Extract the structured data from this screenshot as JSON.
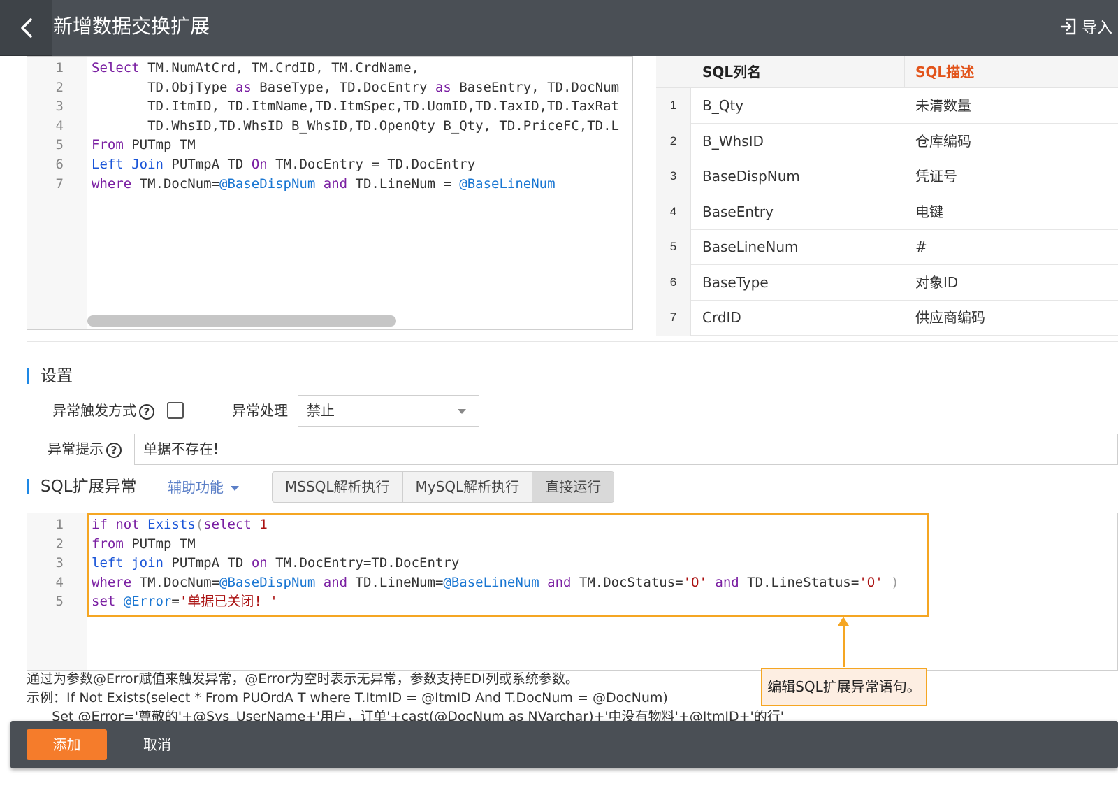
{
  "header": {
    "title": "新增数据交换扩展",
    "import_label": "导入"
  },
  "sql_editor": {
    "lines": [
      {
        "n": "1",
        "parts": [
          [
            "kw",
            "Select"
          ],
          [
            "t",
            " TM.NumAtCrd, TM.CrdID, TM.CrdName,"
          ]
        ]
      },
      {
        "n": "2",
        "parts": [
          [
            "t",
            "       TD.ObjType "
          ],
          [
            "kw",
            "as"
          ],
          [
            "t",
            " BaseType, TD.DocEntry "
          ],
          [
            "kw",
            "as"
          ],
          [
            "t",
            " BaseEntry, TD.DocNum"
          ]
        ]
      },
      {
        "n": "3",
        "parts": [
          [
            "t",
            "       TD.ItmID, TD.ItmName,TD.ItmSpec,TD.UomID,TD.TaxID,TD.TaxRat"
          ]
        ]
      },
      {
        "n": "4",
        "parts": [
          [
            "t",
            "       TD.WhsID,TD.WhsID B_WhsID,TD.OpenQty B_Qty, TD.PriceFC,TD.L"
          ]
        ]
      },
      {
        "n": "5",
        "parts": [
          [
            "kw",
            "From"
          ],
          [
            "t",
            " PUTmp TM"
          ]
        ]
      },
      {
        "n": "6",
        "parts": [
          [
            "kw2",
            "Left"
          ],
          [
            "t",
            " "
          ],
          [
            "kw2",
            "Join"
          ],
          [
            "t",
            " PUTmpA TD "
          ],
          [
            "kw",
            "On"
          ],
          [
            "t",
            " TM.DocEntry = TD.DocEntry"
          ]
        ]
      },
      {
        "n": "7",
        "parts": [
          [
            "kw",
            "where"
          ],
          [
            "t",
            " TM.DocNum="
          ],
          [
            "var",
            "@BaseDispNum"
          ],
          [
            "t",
            " "
          ],
          [
            "kw",
            "and"
          ],
          [
            "t",
            " TD.LineNum = "
          ],
          [
            "var",
            "@BaseLineNum"
          ]
        ]
      }
    ]
  },
  "sql_table": {
    "headers": [
      "SQL列名",
      "SQL描述"
    ],
    "rows": [
      {
        "idx": "1",
        "name": "B_Qty",
        "desc": "未清数量"
      },
      {
        "idx": "2",
        "name": "B_WhsID",
        "desc": "仓库编码"
      },
      {
        "idx": "3",
        "name": "BaseDispNum",
        "desc": "凭证号"
      },
      {
        "idx": "4",
        "name": "BaseEntry",
        "desc": "电键"
      },
      {
        "idx": "5",
        "name": "BaseLineNum",
        "desc": "#"
      },
      {
        "idx": "6",
        "name": "BaseType",
        "desc": "对象ID"
      },
      {
        "idx": "7",
        "name": "CrdID",
        "desc": "供应商编码"
      }
    ]
  },
  "settings": {
    "title": "设置",
    "trigger_label": "异常触发方式",
    "handling_label": "异常处理",
    "handling_value": "禁止",
    "prompt_label": "异常提示",
    "prompt_value": "单据不存在!"
  },
  "sql_exception": {
    "title": "SQL扩展异常",
    "aux_label": "辅助功能",
    "buttons": [
      "MSSQL解析执行",
      "MySQL解析执行",
      "直接运行"
    ],
    "lines": [
      {
        "n": "1",
        "parts": [
          [
            "kw",
            "if"
          ],
          [
            "t",
            " "
          ],
          [
            "kw",
            "not"
          ],
          [
            "t",
            " "
          ],
          [
            "kw2",
            "Exists"
          ],
          [
            "pun",
            "("
          ],
          [
            "kw",
            "select"
          ],
          [
            "t",
            " "
          ],
          [
            "num",
            "1"
          ]
        ]
      },
      {
        "n": "2",
        "parts": [
          [
            "kw",
            "from"
          ],
          [
            "t",
            " PUTmp TM"
          ]
        ]
      },
      {
        "n": "3",
        "parts": [
          [
            "kw2",
            "left"
          ],
          [
            "t",
            " "
          ],
          [
            "kw2",
            "join"
          ],
          [
            "t",
            " PUTmpA TD "
          ],
          [
            "kw",
            "on"
          ],
          [
            "t",
            " TM.DocEntry=TD.DocEntry"
          ]
        ]
      },
      {
        "n": "4",
        "parts": [
          [
            "kw",
            "where"
          ],
          [
            "t",
            " TM.DocNum="
          ],
          [
            "var",
            "@BaseDispNum"
          ],
          [
            "t",
            " "
          ],
          [
            "kw",
            "and"
          ],
          [
            "t",
            " TD.LineNum="
          ],
          [
            "var",
            "@BaseLineNum"
          ],
          [
            "t",
            " "
          ],
          [
            "kw",
            "and"
          ],
          [
            "t",
            " TM.DocStatus="
          ],
          [
            "str",
            "'O'"
          ],
          [
            "t",
            " "
          ],
          [
            "kw",
            "and"
          ],
          [
            "t",
            " TD.LineStatus="
          ],
          [
            "str",
            "'O'"
          ],
          [
            "t",
            " "
          ],
          [
            "pun",
            ")"
          ]
        ]
      },
      {
        "n": "5",
        "parts": [
          [
            "kw",
            "set"
          ],
          [
            "t",
            " "
          ],
          [
            "var",
            "@Error"
          ],
          [
            "t",
            "="
          ],
          [
            "str",
            "'单据已关闭! '"
          ]
        ]
      }
    ],
    "callout": "编辑SQL扩展异常语句。"
  },
  "hint": {
    "line1": "通过为参数@Error赋值来触发异常，@Error为空时表示无异常，参数支持EDI列或系统参数。",
    "line2": "示例：If Not Exists(select * From PUOrdA T where T.ItmID = @ItmID And T.DocNum = @DocNum)",
    "line3": "      Set @Error='尊敬的'+@Sys_UserName+'用户，订单'+cast(@DocNum as NVarchar)+'中没有物料'+@ItmID+'的行'"
  },
  "footer": {
    "add_label": "添加",
    "cancel_label": "取消"
  },
  "colors": {
    "header_bg": "#4a4f55",
    "accent_orange": "#f57c2b",
    "callout_border": "#f5a623",
    "section_bar": "#1e88e5",
    "sql_desc_header": "#e2541b"
  }
}
